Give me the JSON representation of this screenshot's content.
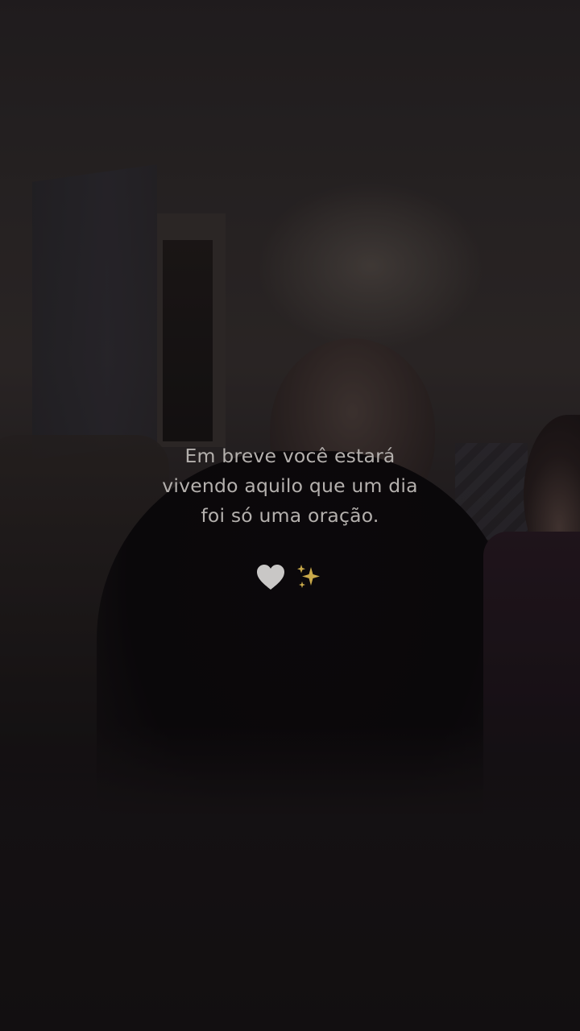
{
  "caption": {
    "line1": "Em breve você estará",
    "line2": "vivendo aquilo que um dia",
    "line3": "foi só uma oração."
  },
  "emojis": {
    "heart": "🤍",
    "icons": [
      "white-heart-icon",
      "sparkles-icon"
    ]
  },
  "colors": {
    "caption_text": "#b4b0ad",
    "sparkles": "#c9a94a",
    "heart": "#c9c7c6"
  }
}
